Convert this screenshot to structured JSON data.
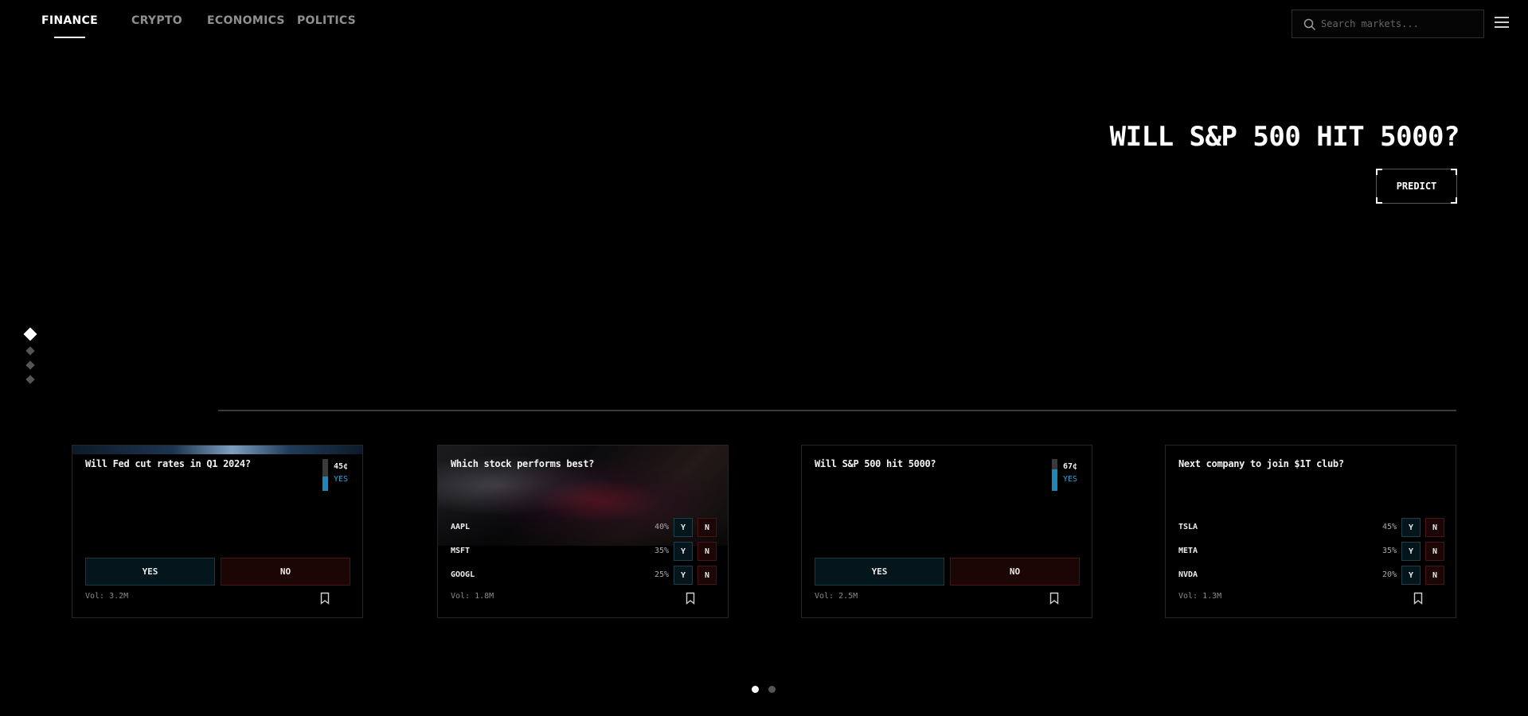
{
  "nav": {
    "tabs": [
      {
        "label": "FINANCE",
        "active": true
      },
      {
        "label": "CRYPTO",
        "active": false
      },
      {
        "label": "ECONOMICS",
        "active": false
      },
      {
        "label": "POLITICS",
        "active": false
      }
    ],
    "search_placeholder": "Search markets...",
    "search_icon": "search-icon",
    "menu_icon": "hamburger-menu-icon"
  },
  "hero": {
    "title": "WILL S&P 500 HIT 5000?",
    "cta_label": "PREDICT",
    "slides_total": 4,
    "active_slide": 1
  },
  "cards": [
    {
      "question": "Will Fed cut rates in Q1 2024?",
      "type": "binary",
      "price": "45¢",
      "yes_fraction": 0.45,
      "side_label": "YES",
      "yes_label": "YES",
      "no_label": "NO",
      "volume": "Vol: 3.2M",
      "bookmark_icon": "bookmark-icon"
    },
    {
      "question": "Which stock performs best?",
      "type": "multi",
      "options": [
        {
          "name": "AAPL",
          "pct": "40%",
          "yes": "Y",
          "no": "N"
        },
        {
          "name": "MSFT",
          "pct": "35%",
          "yes": "Y",
          "no": "N"
        },
        {
          "name": "GOOGL",
          "pct": "25%",
          "yes": "Y",
          "no": "N"
        }
      ],
      "volume": "Vol: 1.8M",
      "bookmark_icon": "bookmark-icon"
    },
    {
      "question": "Will S&P 500 hit 5000?",
      "type": "binary",
      "price": "67¢",
      "yes_fraction": 0.67,
      "side_label": "YES",
      "yes_label": "YES",
      "no_label": "NO",
      "volume": "Vol: 2.5M",
      "bookmark_icon": "bookmark-icon"
    },
    {
      "question": "Next company to join $1T club?",
      "type": "multi",
      "options": [
        {
          "name": "TSLA",
          "pct": "45%",
          "yes": "Y",
          "no": "N"
        },
        {
          "name": "META",
          "pct": "35%",
          "yes": "Y",
          "no": "N"
        },
        {
          "name": "NVDA",
          "pct": "20%",
          "yes": "Y",
          "no": "N"
        }
      ],
      "volume": "Vol: 1.3M",
      "bookmark_icon": "bookmark-icon"
    }
  ],
  "pagination": {
    "pages": 2,
    "active": 1
  },
  "colors": {
    "yes": "#1e86b8",
    "no_bg": "#1b0505",
    "yes_bg": "#04161c",
    "background": "#000000"
  }
}
